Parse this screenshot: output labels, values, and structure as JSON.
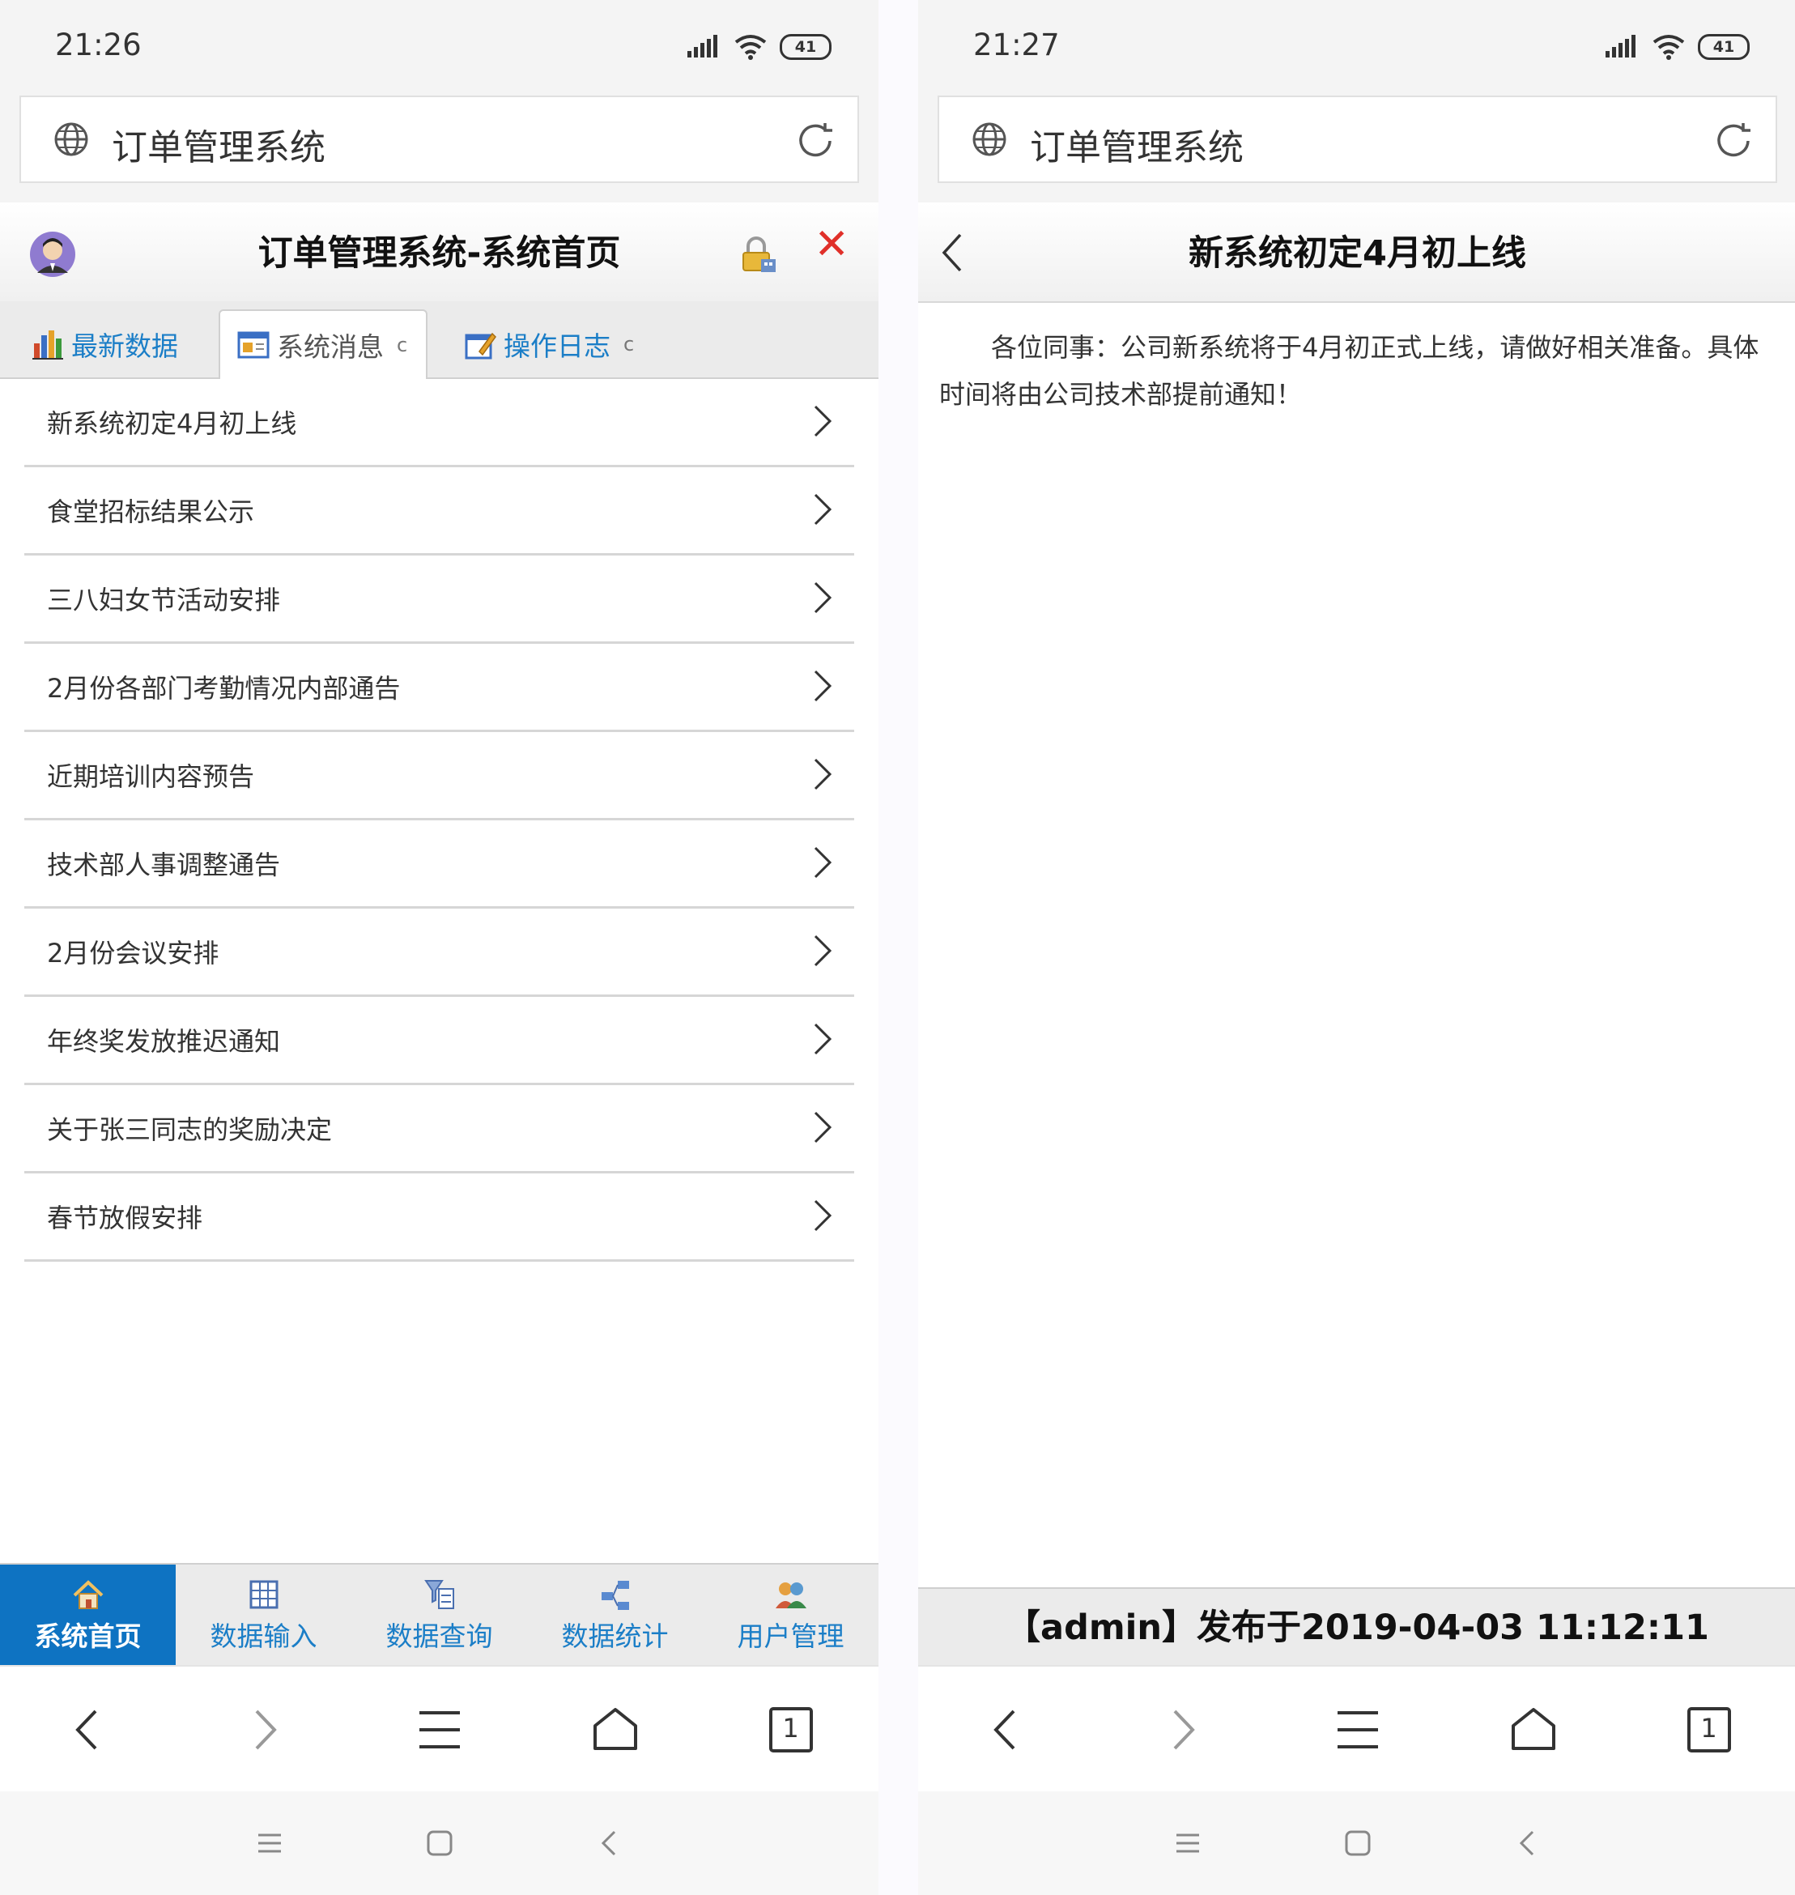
{
  "left": {
    "status": {
      "time": "21:26",
      "battery": "41"
    },
    "address": {
      "title": "订单管理系统"
    },
    "header": {
      "title": "订单管理系统-系统首页"
    },
    "tabs": [
      {
        "label": "最新数据",
        "active": false
      },
      {
        "label": "系统消息",
        "active": true
      },
      {
        "label": "操作日志",
        "active": false
      }
    ],
    "tab_refresh_glyph": "c",
    "messages": [
      "新系统初定4月初上线",
      "食堂招标结果公示",
      "三八妇女节活动安排",
      "2月份各部门考勤情况内部通告",
      "近期培训内容预告",
      "技术部人事调整通告",
      "2月份会议安排",
      "年终奖发放推迟通知",
      "关于张三同志的奖励决定",
      "春节放假安排"
    ],
    "bottom_nav": [
      {
        "label": "系统首页",
        "icon": "home-icon",
        "active": true
      },
      {
        "label": "数据输入",
        "icon": "grid-input-icon",
        "active": false
      },
      {
        "label": "数据查询",
        "icon": "query-icon",
        "active": false
      },
      {
        "label": "数据统计",
        "icon": "stats-icon",
        "active": false
      },
      {
        "label": "用户管理",
        "icon": "users-icon",
        "active": false
      }
    ],
    "browser": {
      "tab_count": "1"
    }
  },
  "right": {
    "status": {
      "time": "21:27",
      "battery": "41"
    },
    "address": {
      "title": "订单管理系统"
    },
    "header": {
      "title": "新系统初定4月初上线"
    },
    "article": {
      "body": "各位同事：公司新系统将于4月初正式上线，请做好相关准备。具体时间将由公司技术部提前通知！"
    },
    "footer": {
      "text": "【admin】发布于2019-04-03 11:12:11"
    },
    "browser": {
      "tab_count": "1"
    }
  },
  "colors": {
    "accent": "#0e73c2",
    "link": "#1b7ec7",
    "close": "#e0302a"
  }
}
